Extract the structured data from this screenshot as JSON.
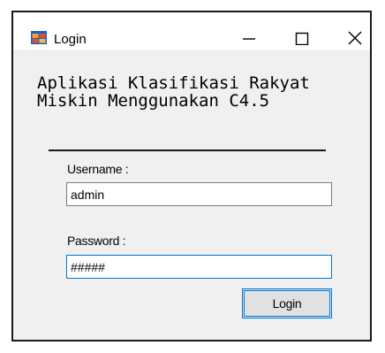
{
  "window": {
    "title": "Login",
    "icon": "app-window-icon",
    "controls": {
      "minimize_icon": "minimize-icon",
      "maximize_icon": "maximize-icon",
      "close_icon": "close-icon"
    }
  },
  "form": {
    "heading": "Aplikasi Klasifikasi Rakyat Miskin Menggunakan C4.5",
    "username_label": "Username :",
    "username_value": "admin",
    "password_label": "Password :",
    "password_value": "#####",
    "login_button": "Login"
  },
  "colors": {
    "focus_border": "#0078d7",
    "window_bg": "#f0f0f0"
  }
}
